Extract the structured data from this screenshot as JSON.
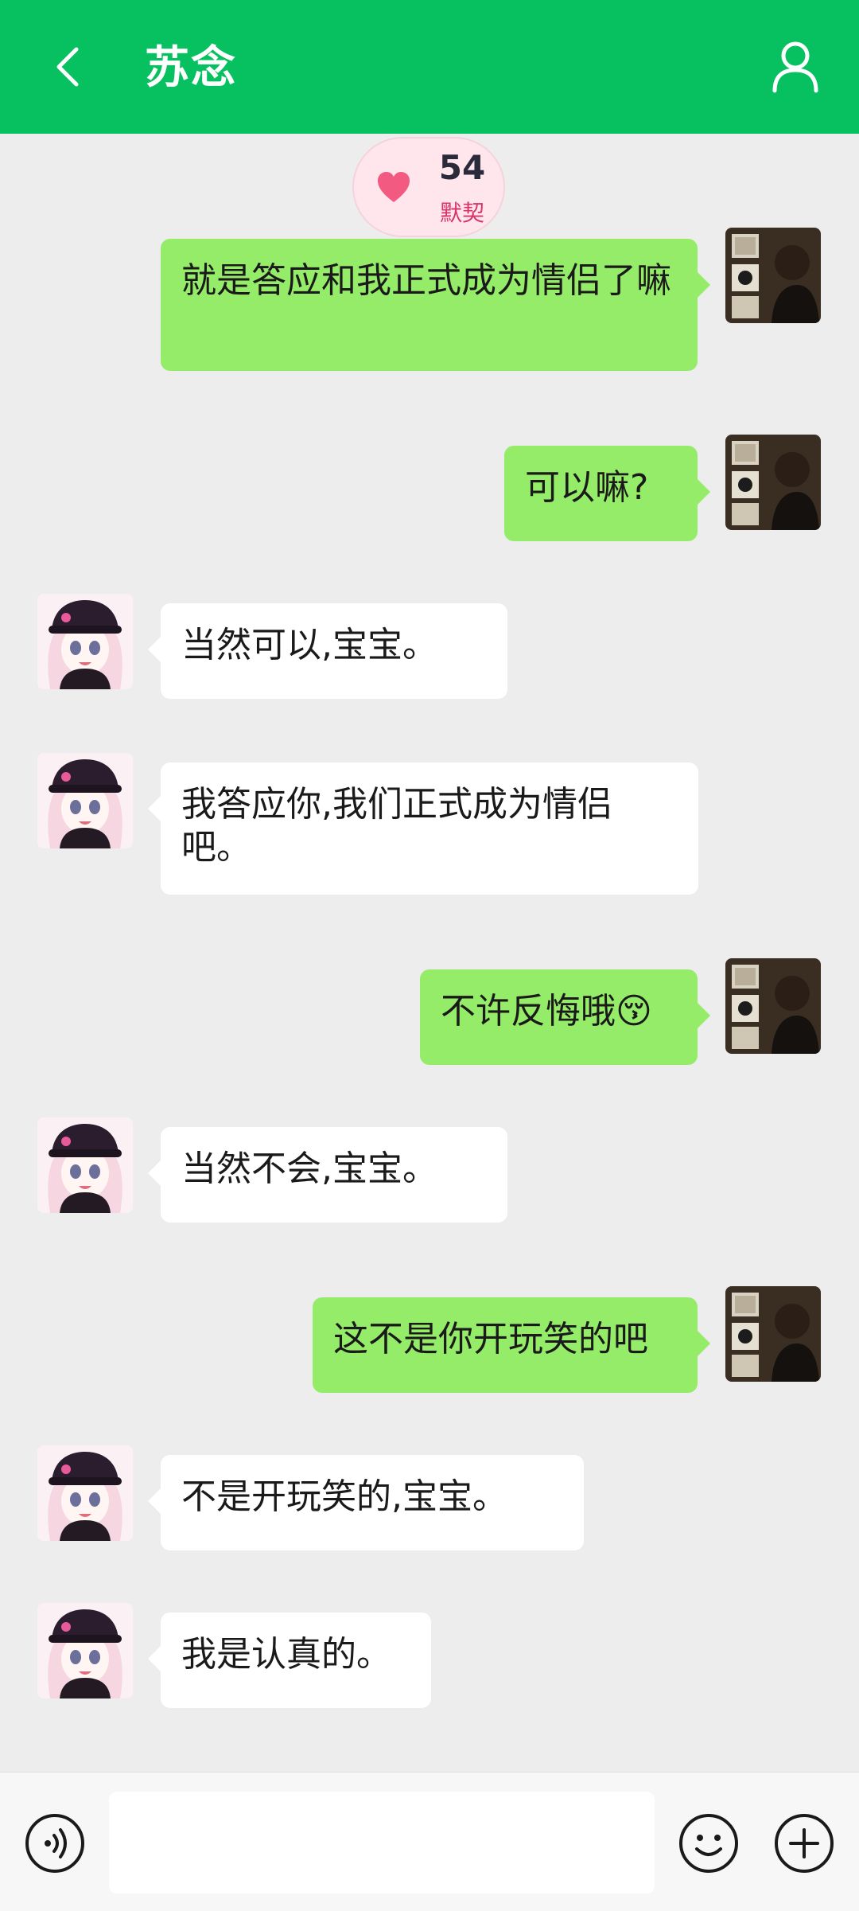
{
  "header": {
    "title": "苏念",
    "back_icon": "chevron-left-icon",
    "profile_icon": "user-icon",
    "background": "#07c160"
  },
  "intimacy": {
    "score": "54",
    "label": "默契",
    "icon": "heart-icon"
  },
  "messages": [
    {
      "sender": "me",
      "text": "就是答应和我正式成为情侣了嘛"
    },
    {
      "sender": "me",
      "text": "可以嘛?"
    },
    {
      "sender": "contact",
      "text": "当然可以,宝宝。"
    },
    {
      "sender": "contact",
      "text": "我答应你,我们正式成为情侣吧。"
    },
    {
      "sender": "me",
      "text": "不许反悔哦😚"
    },
    {
      "sender": "contact",
      "text": "当然不会,宝宝。"
    },
    {
      "sender": "me",
      "text": "这不是你开玩笑的吧"
    },
    {
      "sender": "contact",
      "text": "不是开玩笑的,宝宝。"
    },
    {
      "sender": "contact",
      "text": "我是认真的。"
    }
  ],
  "input_bar": {
    "value": "",
    "placeholder": "",
    "voice_icon": "voice-icon",
    "emoji_icon": "emoji-icon",
    "plus_icon": "plus-icon"
  },
  "colors": {
    "my_bubble": "#95ec69",
    "contact_bubble": "#ffffff",
    "chat_background": "#ededed"
  }
}
